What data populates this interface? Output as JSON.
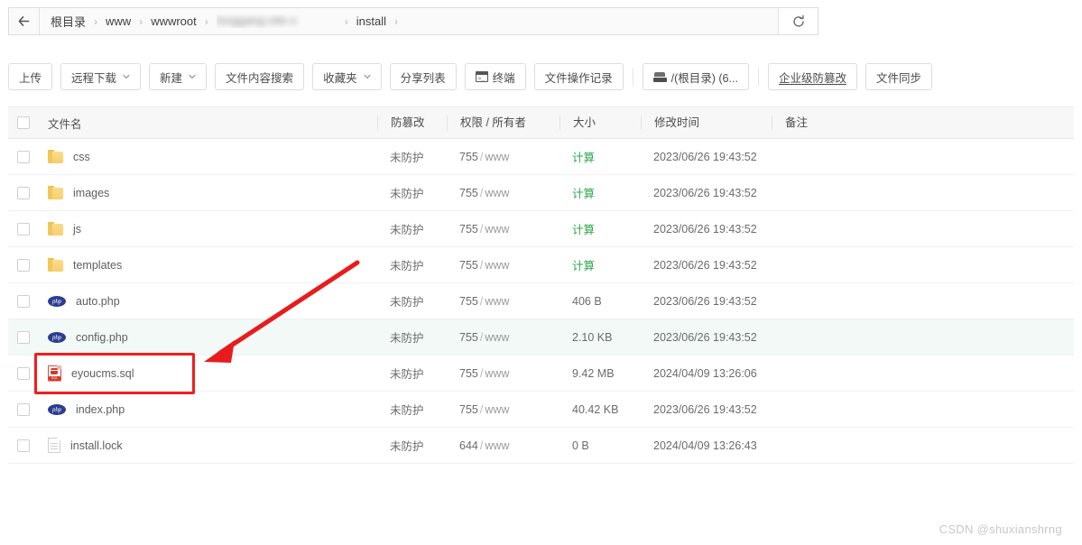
{
  "breadcrumb": {
    "back_icon": "back-arrow-icon",
    "items": [
      "根目录",
      "www",
      "wwwroot",
      "▩▩▩▩▩▩▩▩▩▩",
      "install"
    ],
    "redacted_index": 3,
    "redacted_text": "longgang-site-x",
    "separator": "›",
    "refresh_icon": "refresh-icon"
  },
  "toolbar": {
    "buttons": [
      {
        "label": "上传",
        "caret": false,
        "icon": null,
        "underline": false
      },
      {
        "label": "远程下载",
        "caret": true,
        "icon": null,
        "underline": false
      },
      {
        "label": "新建",
        "caret": true,
        "icon": null,
        "underline": false
      },
      {
        "label": "文件内容搜索",
        "caret": false,
        "icon": null,
        "underline": false
      },
      {
        "label": "收藏夹",
        "caret": true,
        "icon": null,
        "underline": false
      },
      {
        "label": "分享列表",
        "caret": false,
        "icon": null,
        "underline": false
      },
      {
        "label": "终端",
        "caret": false,
        "icon": "terminal-icon",
        "underline": false
      },
      {
        "label": "文件操作记录",
        "caret": false,
        "icon": null,
        "underline": false
      },
      {
        "label": "/(根目录) (6...",
        "caret": false,
        "icon": "disk-icon",
        "underline": false
      },
      {
        "label": "企业级防篡改",
        "caret": false,
        "icon": null,
        "underline": true
      },
      {
        "label": "文件同步",
        "caret": false,
        "icon": null,
        "underline": false
      }
    ],
    "separator_after_index": [
      7,
      8
    ]
  },
  "table": {
    "select_all_icon": "checkbox-icon",
    "headers": [
      "文件名",
      "防篡改",
      "权限 / 所有者",
      "大小",
      "修改时间",
      "备注"
    ],
    "rows": [
      {
        "icon": "folder-icon",
        "name": "css",
        "protect": "未防护",
        "perm": "755",
        "owner": "www",
        "size": "计算",
        "size_is_link": true,
        "time": "2023/06/26 19:43:52",
        "note": "",
        "highlight": false
      },
      {
        "icon": "folder-icon",
        "name": "images",
        "protect": "未防护",
        "perm": "755",
        "owner": "www",
        "size": "计算",
        "size_is_link": true,
        "time": "2023/06/26 19:43:52",
        "note": "",
        "highlight": false
      },
      {
        "icon": "folder-icon",
        "name": "js",
        "protect": "未防护",
        "perm": "755",
        "owner": "www",
        "size": "计算",
        "size_is_link": true,
        "time": "2023/06/26 19:43:52",
        "note": "",
        "highlight": false
      },
      {
        "icon": "folder-icon",
        "name": "templates",
        "protect": "未防护",
        "perm": "755",
        "owner": "www",
        "size": "计算",
        "size_is_link": true,
        "time": "2023/06/26 19:43:52",
        "note": "",
        "highlight": false
      },
      {
        "icon": "php-icon",
        "name": "auto.php",
        "protect": "未防护",
        "perm": "755",
        "owner": "www",
        "size": "406 B",
        "size_is_link": false,
        "time": "2023/06/26 19:43:52",
        "note": "",
        "highlight": false
      },
      {
        "icon": "php-icon",
        "name": "config.php",
        "protect": "未防护",
        "perm": "755",
        "owner": "www",
        "size": "2.10 KB",
        "size_is_link": false,
        "time": "2023/06/26 19:43:52",
        "note": "",
        "highlight": true
      },
      {
        "icon": "sql-icon",
        "name": "eyoucms.sql",
        "protect": "未防护",
        "perm": "755",
        "owner": "www",
        "size": "9.42 MB",
        "size_is_link": false,
        "time": "2024/04/09 13:26:06",
        "note": "",
        "highlight": false
      },
      {
        "icon": "php-icon",
        "name": "index.php",
        "protect": "未防护",
        "perm": "755",
        "owner": "www",
        "size": "40.42 KB",
        "size_is_link": false,
        "time": "2023/06/26 19:43:52",
        "note": "",
        "highlight": false
      },
      {
        "icon": "file-icon",
        "name": "install.lock",
        "protect": "未防护",
        "perm": "644",
        "owner": "www",
        "size": "0 B",
        "size_is_link": false,
        "time": "2024/04/09 13:26:43",
        "note": "",
        "highlight": false
      }
    ],
    "php_icon_text": "php",
    "sql_icon_text": "SQL"
  },
  "annotations": {
    "highlight_box": {
      "target": "eyoucms.sql",
      "color": "#f01e1e",
      "shape": "rectangle"
    },
    "arrow": {
      "color": "#e81c1c",
      "points_to": "eyoucms.sql"
    }
  },
  "watermark": "CSDN @shuxianshrng",
  "colors": {
    "accent_green": "#2aa84a",
    "annotation_red": "#f01e1e",
    "row_highlight": "#f2f9f7",
    "header_bg": "#f7f7f7"
  }
}
